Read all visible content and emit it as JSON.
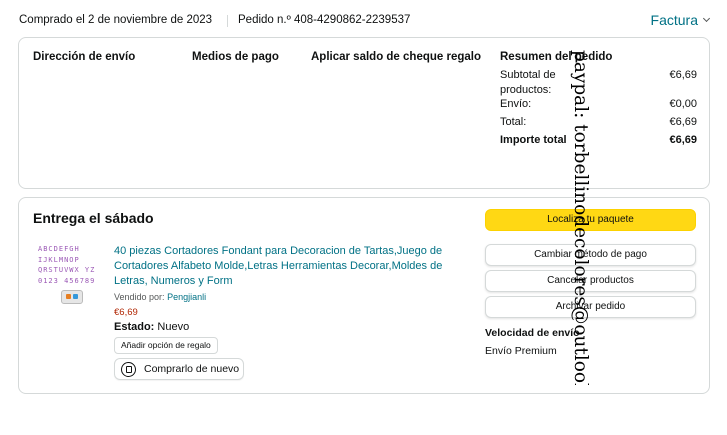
{
  "header": {
    "purchase_date": "Comprado el 2 de noviembre de 2023",
    "order_number": "Pedido n.º 408-4290862-2239537",
    "invoice_label": "Factura"
  },
  "order_info": {
    "shipping_address_heading": "Dirección de envío",
    "payment_methods_heading": "Medios de pago",
    "gift_balance_heading": "Aplicar saldo de cheque regalo",
    "summary": {
      "heading": "Resumen del pedido",
      "rows": [
        {
          "label": "Subtotal de productos:",
          "value": "€6,69"
        },
        {
          "label": "Envío:",
          "value": "€0,00"
        },
        {
          "label": "Total:",
          "value": "€6,69"
        },
        {
          "label": "Importe total",
          "value": "€6,69"
        }
      ]
    }
  },
  "delivery": {
    "title": "Entrega el sábado",
    "product": {
      "thumbnail_letters": "ABCDEFGH IJKLMNOP QRSTUVWX YZ 0123 456789",
      "title": "40 piezas Cortadores Fondant para Decoracion de Tartas,Juego de Cortadores Alfabeto Molde,Letras Herramientas Decorar,Moldes de Letras, Numeros y Form",
      "seller_prefix": "Vendido por:",
      "seller_name": "Pengjianli",
      "price": "€6,69",
      "state_label": "Estado:",
      "state_value": "Nuevo",
      "gift_option_label": "Añadir opción de regalo",
      "rebuy_label": "Comprarlo de nuevo"
    },
    "actions": {
      "track": "Localiza tu paquete",
      "change_payment": "Cambiar método de pago",
      "cancel": "Cancelar productos",
      "archive": "Archivar pedido"
    },
    "shipping_speed_heading": "Velocidad de envío",
    "shipping_speed_value": "Envío Premium"
  },
  "watermark_text": "paypal: torbellinodecolores@outlook.es",
  "colors": {
    "link": "#007185",
    "primary_button": "#FFD814",
    "price": "#B12704",
    "border": "#D5D9D9"
  }
}
